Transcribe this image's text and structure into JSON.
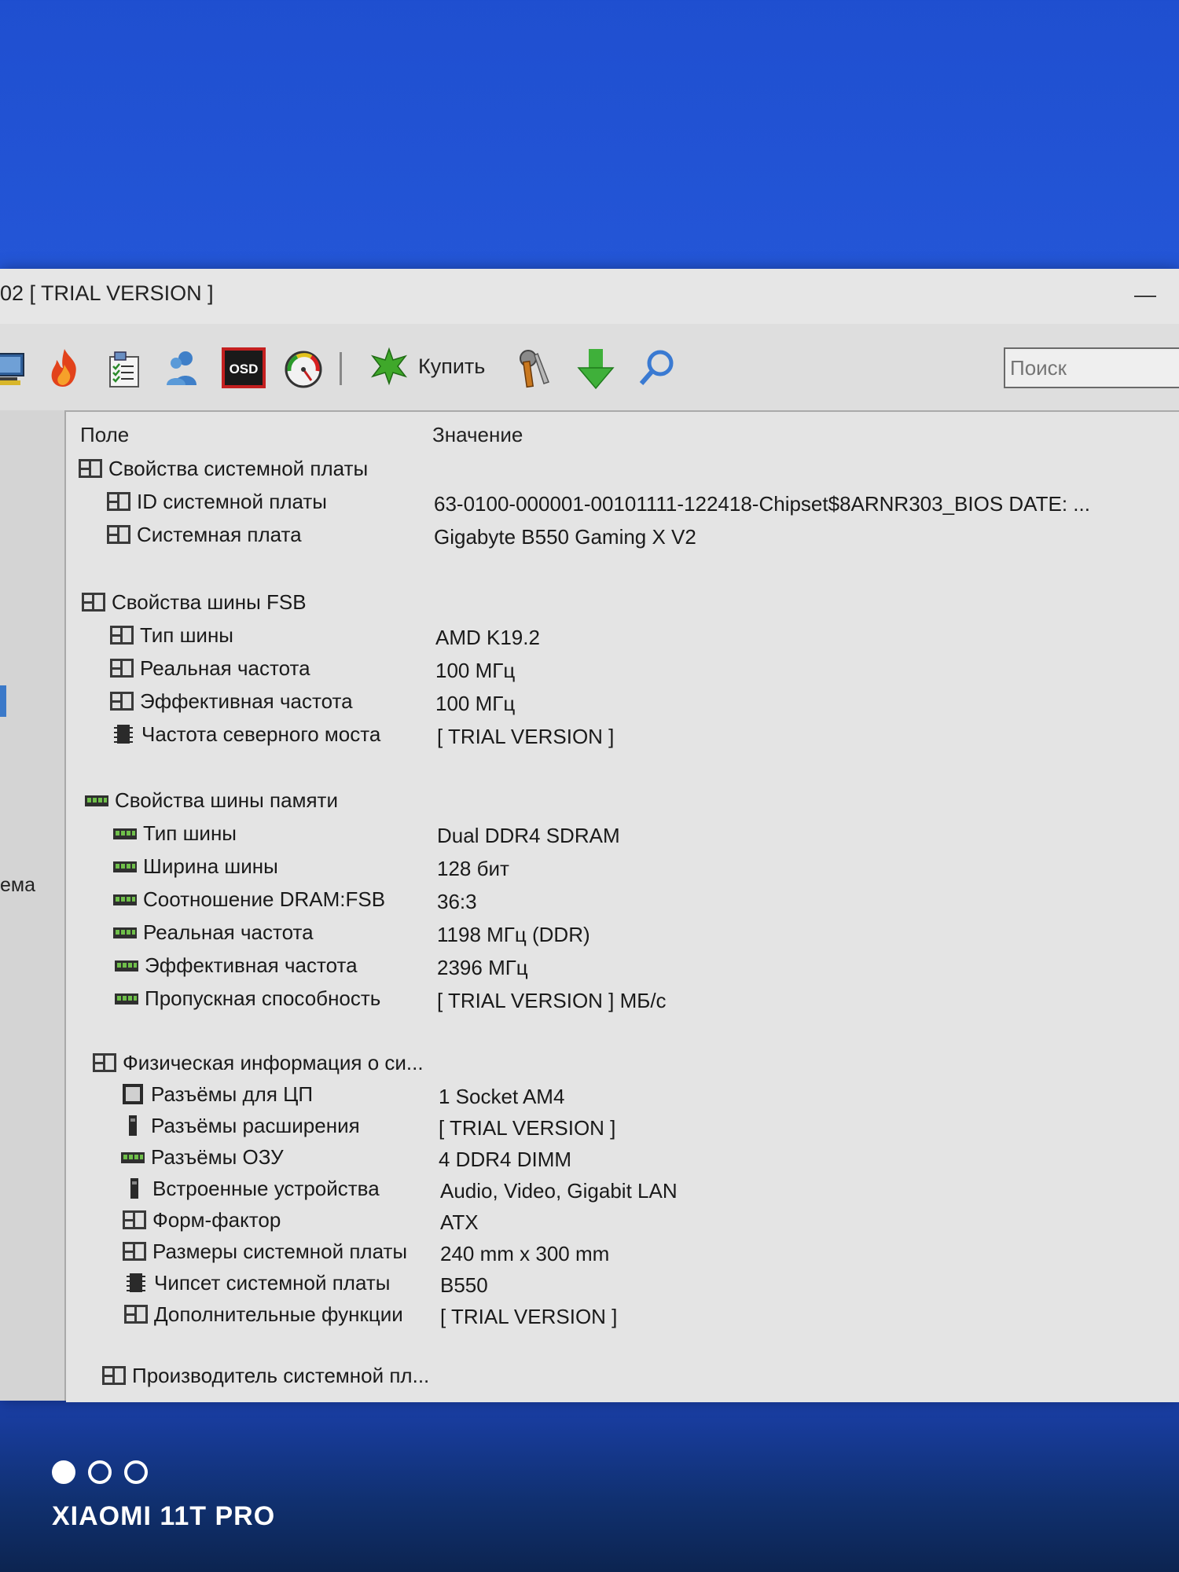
{
  "window": {
    "title": "02  [ TRIAL VERSION ]",
    "minimize_label": "—"
  },
  "toolbar": {
    "icons": [
      "computer-icon",
      "flame-icon",
      "clipboard-list-icon",
      "users-icon",
      "osd-icon",
      "gauge-icon"
    ],
    "buy_label": "Купить",
    "tool_icons": [
      "wrench-icon",
      "download-arrow-icon",
      "search-icon"
    ],
    "search_placeholder": "Поиск"
  },
  "sidebar": {
    "partial_text": "ема"
  },
  "columns": {
    "field": "Поле",
    "value": "Значение"
  },
  "sections": [
    {
      "title": "Свойства системной платы",
      "rows": [
        {
          "field": "ID системной платы",
          "value": "63-0100-000001-00101111-122418-Chipset$8ARNR303_BIOS DATE: ..."
        },
        {
          "field": "Системная плата",
          "value": "Gigabyte B550 Gaming X V2"
        }
      ]
    },
    {
      "title": "Свойства шины FSB",
      "rows": [
        {
          "field": "Тип шины",
          "value": "AMD K19.2"
        },
        {
          "field": "Реальная частота",
          "value": "100 МГц"
        },
        {
          "field": "Эффективная частота",
          "value": "100 МГц"
        },
        {
          "field": "Частота северного моста",
          "value": "[ TRIAL VERSION ]"
        }
      ]
    },
    {
      "title": "Свойства шины памяти",
      "rows": [
        {
          "field": "Тип шины",
          "value": "Dual DDR4 SDRAM"
        },
        {
          "field": "Ширина шины",
          "value": "128 бит"
        },
        {
          "field": "Соотношение DRAM:FSB",
          "value": "36:3"
        },
        {
          "field": "Реальная частота",
          "value": "1198 МГц (DDR)"
        },
        {
          "field": "Эффективная частота",
          "value": "2396 МГц"
        },
        {
          "field": "Пропускная способность",
          "value": "[ TRIAL VERSION ] МБ/с"
        }
      ]
    },
    {
      "title": "Физическая информация о си...",
      "rows": [
        {
          "field": "Разъёмы для ЦП",
          "value": "1 Socket AM4"
        },
        {
          "field": "Разъёмы расширения",
          "value": "[ TRIAL VERSION ]"
        },
        {
          "field": "Разъёмы ОЗУ",
          "value": "4 DDR4 DIMM"
        },
        {
          "field": "Встроенные устройства",
          "value": "Audio, Video, Gigabit LAN"
        },
        {
          "field": "Форм-фактор",
          "value": "ATX"
        },
        {
          "field": "Размеры системной платы",
          "value": "240 mm x 300 mm"
        },
        {
          "field": "Чипсет системной платы",
          "value": "B550"
        },
        {
          "field": "Дополнительные функции",
          "value": "[ TRIAL VERSION ]"
        }
      ]
    },
    {
      "title": "Производитель системной пл...",
      "rows": []
    }
  ],
  "photo_watermark": "XIAOMI 11T PRO"
}
